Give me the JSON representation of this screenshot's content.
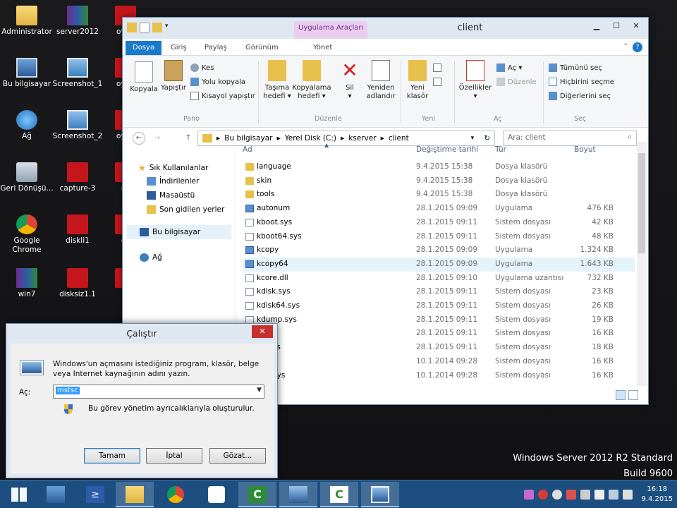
{
  "desktop": {
    "icons": [
      {
        "label": "Administrator",
        "kind": "folder"
      },
      {
        "label": "server2012",
        "kind": "rar"
      },
      {
        "label": "oyun",
        "kind": "red"
      },
      {
        "label": "Bu bilgisayar",
        "kind": "pc"
      },
      {
        "label": "Screenshot_1",
        "kind": "img"
      },
      {
        "label": "oyun",
        "kind": "red"
      },
      {
        "label": "Ağ",
        "kind": "globe"
      },
      {
        "label": "Screenshot_2",
        "kind": "img"
      },
      {
        "label": "oyun",
        "kind": "red"
      },
      {
        "label": "Geri Dönüşü...",
        "kind": "bin"
      },
      {
        "label": "capture-3",
        "kind": "red"
      },
      {
        "label": "ca",
        "kind": "red"
      },
      {
        "label": "Google Chrome",
        "kind": "chrome"
      },
      {
        "label": "diskli1",
        "kind": "red"
      },
      {
        "label": "ca",
        "kind": "red"
      },
      {
        "label": "win7",
        "kind": "rar"
      },
      {
        "label": "disksiz1.1",
        "kind": "red"
      },
      {
        "label": "U",
        "kind": "red"
      }
    ],
    "watermark_line1": "Windows Server 2012 R2 Standard",
    "watermark_line2": "Build 9600"
  },
  "explorer": {
    "title": "client",
    "context_tab": "Uygulama Araçları",
    "controls": {
      "minimize": "▁",
      "maximize": "☐",
      "close": "✕"
    },
    "tabs": {
      "file": "Dosya",
      "home": "Giriş",
      "share": "Paylaş",
      "view": "Görünüm",
      "manage": "Yönet"
    },
    "ribbon": {
      "copy": "Kopyala",
      "paste": "Yapıştır",
      "cut": "Kes",
      "copy_path": "Yolu kopyala",
      "paste_shortcut": "Kısayol yapıştır",
      "move_to_1": "Taşıma",
      "move_to_2": "hedefi ▾",
      "copy_to_1": "Kopyalama",
      "copy_to_2": "hedefi ▾",
      "delete_1": "Sil",
      "delete_2": "▾",
      "rename_1": "Yeniden",
      "rename_2": "adlandır",
      "new_folder_1": "Yeni",
      "new_folder_2": "klasör",
      "properties_1": "Özellikler",
      "properties_2": "▾",
      "open": "Aç ▾",
      "edit": "Düzenle",
      "select_all": "Tümünü seç",
      "select_none": "Hiçbirini seçme",
      "invert": "Diğerlerini seç",
      "group_clipboard": "Pano",
      "group_organize": "Düzenle",
      "group_new": "Yeni",
      "group_open": "Aç",
      "group_select": "Seç"
    },
    "address": {
      "back": "←",
      "forward": "→",
      "up": "↑",
      "crumbs": [
        "▸",
        "Bu bilgisayar",
        "▸",
        "Yerel Disk (C:)",
        "▸",
        "kserver",
        "▸",
        "client"
      ],
      "refresh": "↻",
      "search_placeholder": "Ara: client"
    },
    "nav": {
      "favorites": "Sık Kullanılanlar",
      "downloads": "İndirilenler",
      "desktop": "Masaüstü",
      "recent": "Son gidilen yerler",
      "this_pc": "Bu bilgisayar",
      "network": "Ağ"
    },
    "columns": {
      "name": "Ad",
      "date": "Değiştirme tarihi",
      "type": "Tür",
      "size": "Boyut"
    },
    "files": [
      {
        "name": "language",
        "date": "9.4.2015 15:38",
        "type": "Dosya klasörü",
        "size": "",
        "kind": "folder"
      },
      {
        "name": "skin",
        "date": "9.4.2015 15:38",
        "type": "Dosya klasörü",
        "size": "",
        "kind": "folder"
      },
      {
        "name": "tools",
        "date": "9.4.2015 15:38",
        "type": "Dosya klasörü",
        "size": "",
        "kind": "folder"
      },
      {
        "name": "autonum",
        "date": "28.1.2015 09:09",
        "type": "Uygulama",
        "size": "476 KB",
        "kind": "app"
      },
      {
        "name": "kboot.sys",
        "date": "28.1.2015 09:11",
        "type": "Sistem dosyası",
        "size": "42 KB",
        "kind": "sys"
      },
      {
        "name": "kboot64.sys",
        "date": "28.1.2015 09:11",
        "type": "Sistem dosyası",
        "size": "48 KB",
        "kind": "sys"
      },
      {
        "name": "kcopy",
        "date": "28.1.2015 09:09",
        "type": "Uygulama",
        "size": "1.324 KB",
        "kind": "app"
      },
      {
        "name": "kcopy64",
        "date": "28.1.2015 09:09",
        "type": "Uygulama",
        "size": "1.643 KB",
        "kind": "app"
      },
      {
        "name": "kcore.dll",
        "date": "28.1.2015 09:10",
        "type": "Uygulama uzantısı",
        "size": "732 KB",
        "kind": "sys"
      },
      {
        "name": "kdisk.sys",
        "date": "28.1.2015 09:11",
        "type": "Sistem dosyası",
        "size": "23 KB",
        "kind": "sys"
      },
      {
        "name": "kdisk64.sys",
        "date": "28.1.2015 09:11",
        "type": "Sistem dosyası",
        "size": "26 KB",
        "kind": "sys"
      },
      {
        "name": "kdump.sys",
        "date": "28.1.2015 09:11",
        "type": "Sistem dosyası",
        "size": "19 KB",
        "kind": "sys"
      },
      {
        "name": ".sys",
        "date": "28.1.2015 09:11",
        "type": "Sistem dosyası",
        "size": "16 KB",
        "kind": "sys"
      },
      {
        "name": "64.sys",
        "date": "28.1.2015 09:11",
        "type": "Sistem dosyası",
        "size": "18 KB",
        "kind": "sys"
      },
      {
        "name": "e.sys",
        "date": "10.1.2014 09:28",
        "type": "Sistem dosyası",
        "size": "16 KB",
        "kind": "sys"
      },
      {
        "name": "e64.sys",
        "date": "10.1.2014 09:28",
        "type": "Sistem dosyası",
        "size": "16 KB",
        "kind": "sys"
      }
    ],
    "selected_row": 7
  },
  "run": {
    "title": "Çalıştır",
    "close": "✕",
    "description": "Windows'un açmasını istediğiniz program, klasör, belge veya Internet kaynağının adını yazın.",
    "open_label": "Aç:",
    "input_value": "mstsc",
    "admin_note": "Bu görev yönetim ayrıcalıklarıyla oluşturulur.",
    "ok": "Tamam",
    "cancel": "İptal",
    "browse": "Gözat..."
  },
  "taskbar": {
    "time": "16:18",
    "date": "9.4.2015"
  }
}
